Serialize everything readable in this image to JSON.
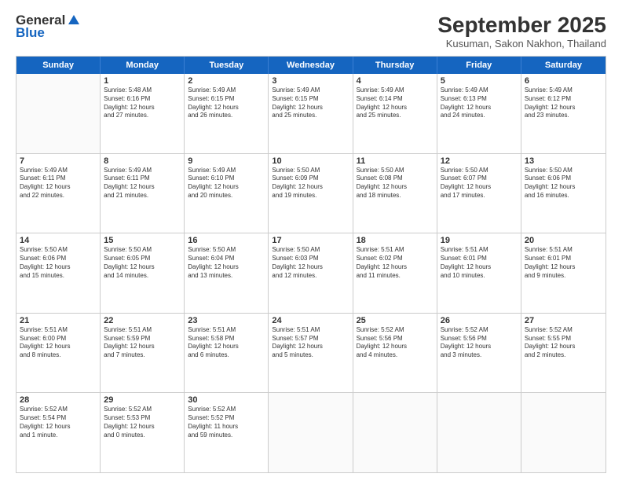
{
  "header": {
    "logo_line1": "General",
    "logo_line2": "Blue",
    "month_title": "September 2025",
    "subtitle": "Kusuman, Sakon Nakhon, Thailand"
  },
  "days": [
    "Sunday",
    "Monday",
    "Tuesday",
    "Wednesday",
    "Thursday",
    "Friday",
    "Saturday"
  ],
  "weeks": [
    [
      {
        "day": "",
        "empty": true
      },
      {
        "day": "1",
        "rise": "5:48 AM",
        "set": "6:16 PM",
        "dh": "12 hours",
        "dm": "and 27 minutes."
      },
      {
        "day": "2",
        "rise": "5:49 AM",
        "set": "6:15 PM",
        "dh": "12 hours",
        "dm": "and 26 minutes."
      },
      {
        "day": "3",
        "rise": "5:49 AM",
        "set": "6:15 PM",
        "dh": "12 hours",
        "dm": "and 25 minutes."
      },
      {
        "day": "4",
        "rise": "5:49 AM",
        "set": "6:14 PM",
        "dh": "12 hours",
        "dm": "and 25 minutes."
      },
      {
        "day": "5",
        "rise": "5:49 AM",
        "set": "6:13 PM",
        "dh": "12 hours",
        "dm": "and 24 minutes."
      },
      {
        "day": "6",
        "rise": "5:49 AM",
        "set": "6:12 PM",
        "dh": "12 hours",
        "dm": "and 23 minutes."
      }
    ],
    [
      {
        "day": "7",
        "rise": "5:49 AM",
        "set": "6:11 PM",
        "dh": "12 hours",
        "dm": "and 22 minutes."
      },
      {
        "day": "8",
        "rise": "5:49 AM",
        "set": "6:11 PM",
        "dh": "12 hours",
        "dm": "and 21 minutes."
      },
      {
        "day": "9",
        "rise": "5:49 AM",
        "set": "6:10 PM",
        "dh": "12 hours",
        "dm": "and 20 minutes."
      },
      {
        "day": "10",
        "rise": "5:50 AM",
        "set": "6:09 PM",
        "dh": "12 hours",
        "dm": "and 19 minutes."
      },
      {
        "day": "11",
        "rise": "5:50 AM",
        "set": "6:08 PM",
        "dh": "12 hours",
        "dm": "and 18 minutes."
      },
      {
        "day": "12",
        "rise": "5:50 AM",
        "set": "6:07 PM",
        "dh": "12 hours",
        "dm": "and 17 minutes."
      },
      {
        "day": "13",
        "rise": "5:50 AM",
        "set": "6:06 PM",
        "dh": "12 hours",
        "dm": "and 16 minutes."
      }
    ],
    [
      {
        "day": "14",
        "rise": "5:50 AM",
        "set": "6:06 PM",
        "dh": "12 hours",
        "dm": "and 15 minutes."
      },
      {
        "day": "15",
        "rise": "5:50 AM",
        "set": "6:05 PM",
        "dh": "12 hours",
        "dm": "and 14 minutes."
      },
      {
        "day": "16",
        "rise": "5:50 AM",
        "set": "6:04 PM",
        "dh": "12 hours",
        "dm": "and 13 minutes."
      },
      {
        "day": "17",
        "rise": "5:50 AM",
        "set": "6:03 PM",
        "dh": "12 hours",
        "dm": "and 12 minutes."
      },
      {
        "day": "18",
        "rise": "5:51 AM",
        "set": "6:02 PM",
        "dh": "12 hours",
        "dm": "and 11 minutes."
      },
      {
        "day": "19",
        "rise": "5:51 AM",
        "set": "6:01 PM",
        "dh": "12 hours",
        "dm": "and 10 minutes."
      },
      {
        "day": "20",
        "rise": "5:51 AM",
        "set": "6:01 PM",
        "dh": "12 hours",
        "dm": "and 9 minutes."
      }
    ],
    [
      {
        "day": "21",
        "rise": "5:51 AM",
        "set": "6:00 PM",
        "dh": "12 hours",
        "dm": "and 8 minutes."
      },
      {
        "day": "22",
        "rise": "5:51 AM",
        "set": "5:59 PM",
        "dh": "12 hours",
        "dm": "and 7 minutes."
      },
      {
        "day": "23",
        "rise": "5:51 AM",
        "set": "5:58 PM",
        "dh": "12 hours",
        "dm": "and 6 minutes."
      },
      {
        "day": "24",
        "rise": "5:51 AM",
        "set": "5:57 PM",
        "dh": "12 hours",
        "dm": "and 5 minutes."
      },
      {
        "day": "25",
        "rise": "5:52 AM",
        "set": "5:56 PM",
        "dh": "12 hours",
        "dm": "and 4 minutes."
      },
      {
        "day": "26",
        "rise": "5:52 AM",
        "set": "5:56 PM",
        "dh": "12 hours",
        "dm": "and 3 minutes."
      },
      {
        "day": "27",
        "rise": "5:52 AM",
        "set": "5:55 PM",
        "dh": "12 hours",
        "dm": "and 2 minutes."
      }
    ],
    [
      {
        "day": "28",
        "rise": "5:52 AM",
        "set": "5:54 PM",
        "dh": "12 hours",
        "dm": "and 1 minute."
      },
      {
        "day": "29",
        "rise": "5:52 AM",
        "set": "5:53 PM",
        "dh": "12 hours",
        "dm": "and 0 minutes."
      },
      {
        "day": "30",
        "rise": "5:52 AM",
        "set": "5:52 PM",
        "dh": "11 hours",
        "dm": "and 59 minutes."
      },
      {
        "day": "",
        "empty": true
      },
      {
        "day": "",
        "empty": true
      },
      {
        "day": "",
        "empty": true
      },
      {
        "day": "",
        "empty": true
      }
    ]
  ]
}
